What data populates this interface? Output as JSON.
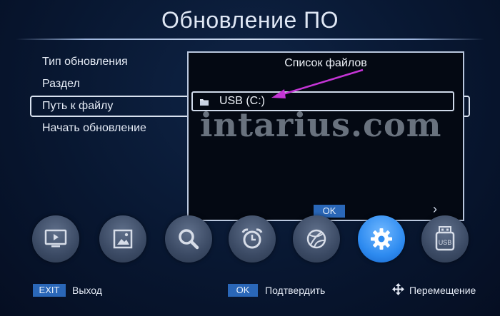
{
  "header": {
    "title": "Обновление ПО"
  },
  "menu": {
    "items": [
      {
        "label": "Тип обновления"
      },
      {
        "label": "Раздел"
      },
      {
        "label": "Путь к файлу"
      },
      {
        "label": "Начать обновление"
      }
    ],
    "selected_index": 2
  },
  "dialog": {
    "title": "Список файлов",
    "files": [
      {
        "label": "USB (C:)",
        "icon": "folder-icon"
      }
    ],
    "ok_label": "OK",
    "next_icon": "chevron-right-icon"
  },
  "watermark": "intarius.com",
  "icon_bar": [
    {
      "icon": "tv-icon"
    },
    {
      "icon": "picture-icon"
    },
    {
      "icon": "search-icon"
    },
    {
      "icon": "alarm-clock-icon"
    },
    {
      "icon": "globe-icon"
    },
    {
      "icon": "gear-icon",
      "active": true
    },
    {
      "icon": "usb-icon",
      "label": "USB"
    }
  ],
  "footer": {
    "exit_key": "EXIT",
    "exit_label": "Выход",
    "ok_key": "OK",
    "ok_label": "Подтвердить",
    "move_label": "Перемещение",
    "move_icon": "move-arrows-icon"
  },
  "colors": {
    "accent": "#2a67b8",
    "active_icon": "#2e8bf0",
    "arrow": "#c535d6",
    "background": "#081731"
  }
}
